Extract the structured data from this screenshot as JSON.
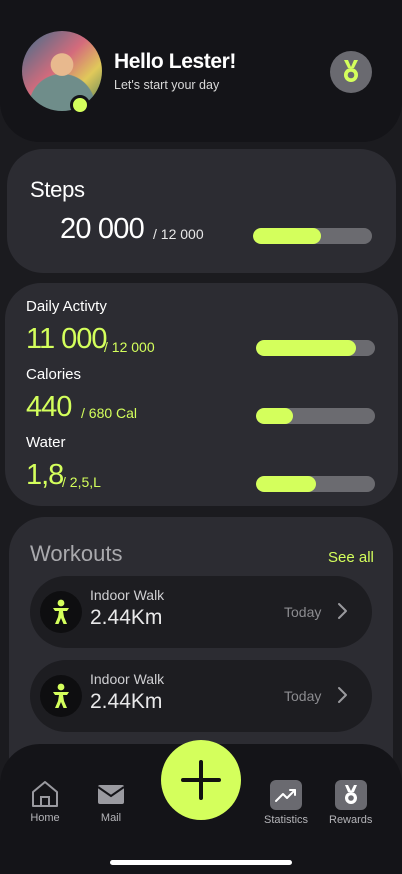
{
  "header": {
    "greeting": "Hello Lester!",
    "subtitle": "Let's start your day",
    "avatar_icon": "user-avatar",
    "rewards_icon": "medal-icon"
  },
  "steps": {
    "title": "Steps",
    "value": "20 000",
    "goal": "/ 12 000",
    "progress": 0.57
  },
  "activity": {
    "daily": {
      "label": "Daily Activty",
      "value": "11 000",
      "goal": "/ 12 000",
      "progress": 0.84
    },
    "calories": {
      "label": "Calories",
      "value": "440",
      "goal": "/ 680 Cal",
      "progress": 0.31
    },
    "water": {
      "label": "Water",
      "value": "1,8",
      "goal": "/ 2,5,L",
      "progress": 0.5
    }
  },
  "workouts": {
    "title": "Workouts",
    "see_all": "See all",
    "items": [
      {
        "name": "Indoor Walk",
        "distance": "2.44Km",
        "when": "Today",
        "icon": "walking-icon"
      },
      {
        "name": "Indoor Walk",
        "distance": "2.44Km",
        "when": "Today",
        "icon": "walking-icon"
      }
    ]
  },
  "nav": {
    "home": "Home",
    "mail": "Mail",
    "statistics": "Statistics",
    "rewards": "Rewards",
    "add_icon": "plus-icon"
  },
  "colors": {
    "accent": "#d4ff5c",
    "background": "#1b1b1f",
    "card": "#2c2c32"
  }
}
